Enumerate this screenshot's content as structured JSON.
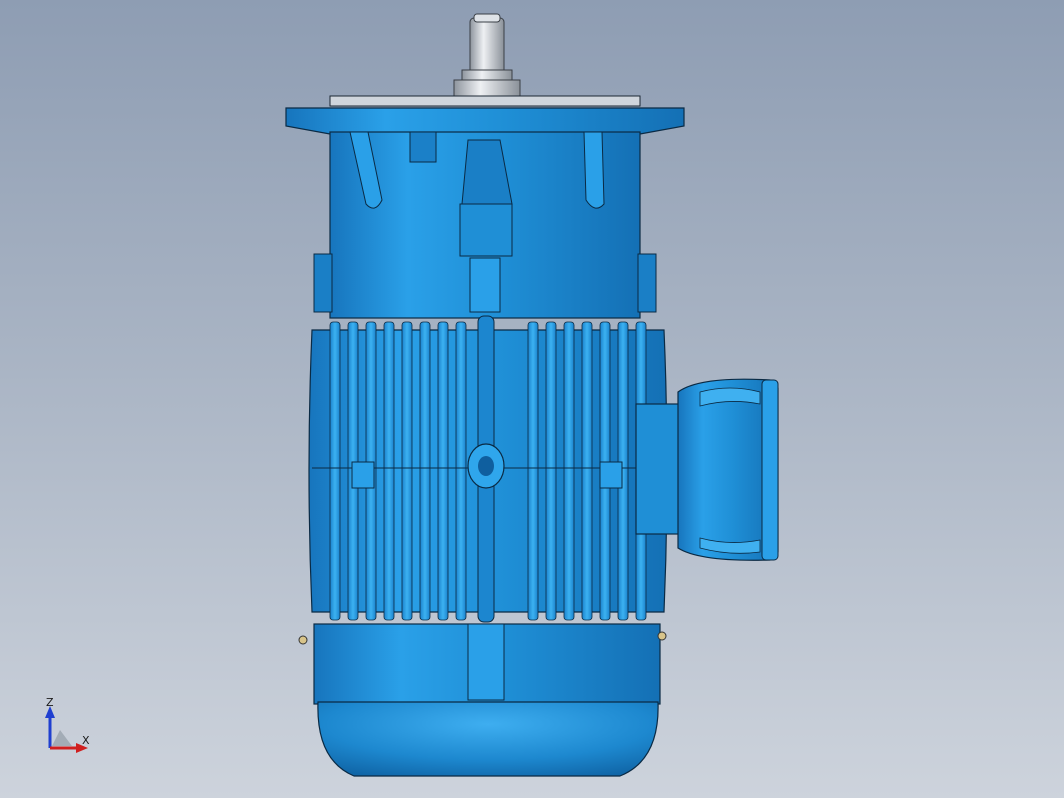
{
  "viewport": {
    "background_top": "#8e9db3",
    "background_bottom": "#cdd3dc"
  },
  "model": {
    "part_color": "#1f8fd6",
    "part_highlight": "#3fb0f0",
    "part_shadow": "#0d5d9a",
    "edge_color": "#0a2a44",
    "shaft_color": "#c9ced6"
  },
  "triad": {
    "z_label": "Z",
    "x_label": "X",
    "z_color": "#1f3fd0",
    "x_color": "#d01f1f"
  }
}
